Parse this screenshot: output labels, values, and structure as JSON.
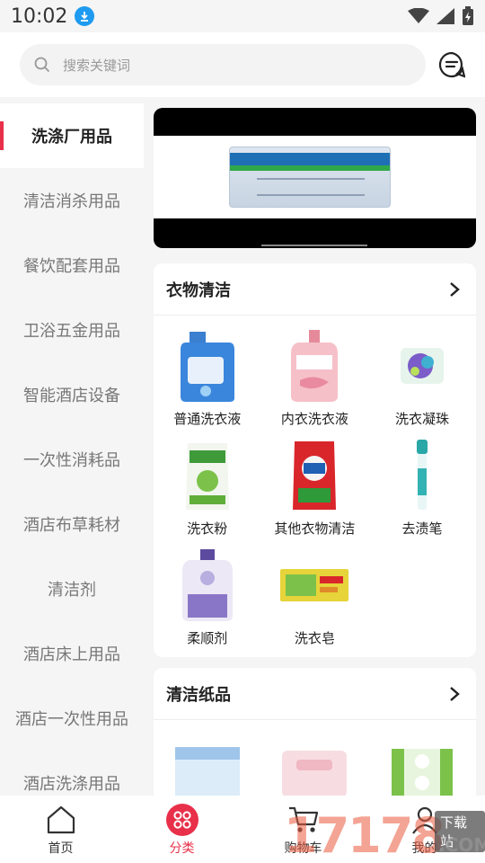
{
  "status": {
    "time": "10:02"
  },
  "search": {
    "placeholder": "搜索关键词"
  },
  "sidebar": {
    "items": [
      {
        "label": "洗涤厂用品",
        "active": true
      },
      {
        "label": "清洁消杀用品"
      },
      {
        "label": "餐饮配套用品"
      },
      {
        "label": "卫浴五金用品"
      },
      {
        "label": "智能酒店设备"
      },
      {
        "label": "一次性消耗品"
      },
      {
        "label": "酒店布草耗材"
      },
      {
        "label": "清洁剂"
      },
      {
        "label": "酒店床上用品"
      },
      {
        "label": "酒店一次性用品"
      },
      {
        "label": "酒店洗涤用品"
      }
    ]
  },
  "sections": [
    {
      "title": "衣物清洁",
      "products": [
        {
          "label": "普通洗衣液",
          "color": "#2f7fd6"
        },
        {
          "label": "内衣洗衣液",
          "color": "#f2a3ae"
        },
        {
          "label": "洗衣凝珠",
          "color": "#7b5cc8"
        },
        {
          "label": "洗衣粉",
          "color": "#4ca33c"
        },
        {
          "label": "其他衣物清洁",
          "color": "#d9262b"
        },
        {
          "label": "去渍笔",
          "color": "#2aa7a7"
        },
        {
          "label": "柔顺剂",
          "color": "#8a76c6"
        },
        {
          "label": "洗衣皂",
          "color": "#e6d43a"
        }
      ]
    },
    {
      "title": "清洁纸品",
      "products": [
        {
          "label": "",
          "color": "#9fc6ea"
        },
        {
          "label": "",
          "color": "#f0b8c2"
        },
        {
          "label": "",
          "color": "#7cc24a"
        }
      ]
    }
  ],
  "tabbar": {
    "items": [
      {
        "label": "首页"
      },
      {
        "label": "分类",
        "active": true
      },
      {
        "label": "购物车"
      },
      {
        "label": "我的"
      }
    ]
  },
  "watermark": {
    "number": "17178",
    "badge": "下载站",
    "domain": ".COM"
  },
  "colors": {
    "accent": "#e8304a"
  }
}
